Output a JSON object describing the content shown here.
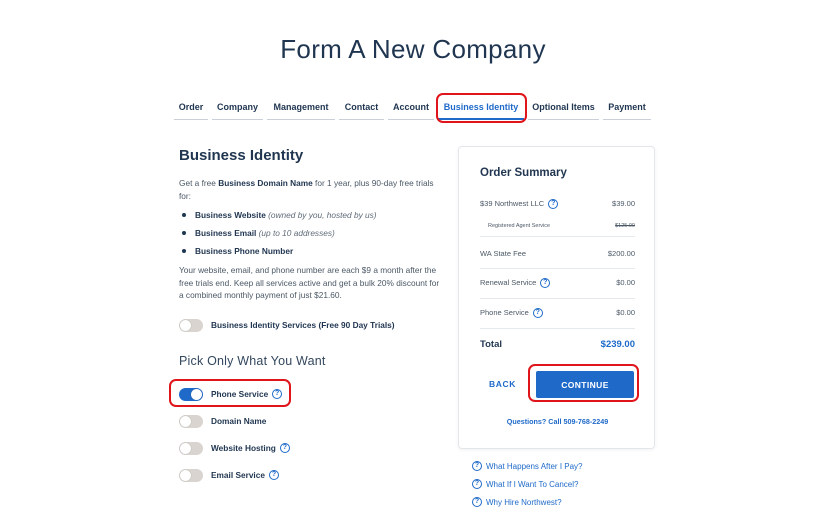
{
  "page": {
    "title": "Form A New Company"
  },
  "tabs": [
    {
      "label": "Order"
    },
    {
      "label": "Company"
    },
    {
      "label": "Management"
    },
    {
      "label": "Contact"
    },
    {
      "label": "Account"
    },
    {
      "label": "Business Identity"
    },
    {
      "label": "Optional Items"
    },
    {
      "label": "Payment"
    }
  ],
  "active_tab": "Business Identity",
  "section": {
    "title": "Business Identity",
    "intro_pre": "Get a free ",
    "intro_bold": "Business Domain Name",
    "intro_post": " for 1 year, plus 90-day free trials for:",
    "features": [
      {
        "name": "Business Website",
        "note": "(owned by you, hosted by us)"
      },
      {
        "name": "Business Email",
        "note": "(up to 10 addresses)"
      },
      {
        "name": "Business Phone Number",
        "note": ""
      }
    ],
    "pricing_note": "Your website, email, and phone number are each $9 a month after the free trials end. Keep all services active and get a bulk 20% discount for a combined monthly payment of just $21.60.",
    "bundle_toggle_label": "Business Identity Services (Free 90 Day Trials)",
    "bundle_on": false,
    "pick_title": "Pick Only What You Want",
    "services": [
      {
        "label": "Phone Service",
        "on": true
      },
      {
        "label": "Domain Name",
        "on": false
      },
      {
        "label": "Website Hosting",
        "on": false
      },
      {
        "label": "Email Service",
        "on": false
      }
    ]
  },
  "summary": {
    "title": "Order Summary",
    "lines": [
      {
        "label": "$39 Northwest LLC",
        "amount": "$39.00",
        "help": true
      },
      {
        "label": "WA State Fee",
        "amount": "$200.00",
        "help": false
      },
      {
        "label": "Renewal Service",
        "amount": "$0.00",
        "help": true
      },
      {
        "label": "Phone Service",
        "amount": "$0.00",
        "help": true
      }
    ],
    "sub_line": {
      "label": "Registered Agent Service",
      "amount": "$125.00"
    },
    "total_label": "Total",
    "total_amount": "$239.00",
    "back_label": "BACK",
    "continue_label": "CONTINUE",
    "questions": "Questions? Call 509-768-2249"
  },
  "faq": [
    {
      "label": "What Happens After I Pay?"
    },
    {
      "label": "What If I Want To Cancel?"
    },
    {
      "label": "Why Hire Northwest?"
    }
  ],
  "colors": {
    "accent": "#1f6ac9",
    "heading": "#1f3550",
    "highlight": "#e0141b",
    "toggle_off": "#d9d4cf"
  },
  "icons": {
    "help": "question-circle-icon"
  }
}
